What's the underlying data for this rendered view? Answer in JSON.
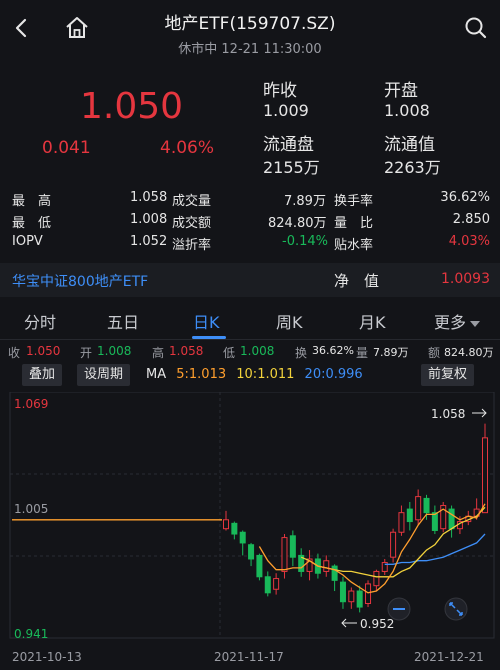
{
  "header": {
    "title": "地产ETF(159707.SZ)",
    "subtitle": "休市中 12-21 11:30:00"
  },
  "quote": {
    "price": "1.050",
    "change": "0.041",
    "change_pct": "4.06%",
    "prev_close_label": "昨收",
    "prev_close": "1.009",
    "open_label": "开盘",
    "open": "1.008",
    "float_shares_label": "流通盘",
    "float_shares": "2155万",
    "float_value_label": "流通值",
    "float_value": "2263万"
  },
  "stats": [
    {
      "l1": "最　高",
      "v1": "1.058",
      "l2": "成交量",
      "v2": "7.89万",
      "l3": "换手率",
      "v3": "36.62%"
    },
    {
      "l1": "最　低",
      "v1": "1.008",
      "l2": "成交额",
      "v2": "824.80万",
      "l3": "量　比",
      "v3": "2.850"
    },
    {
      "l1": "IOPV",
      "v1": "1.052",
      "l2": "溢折率",
      "v2": "-0.14%",
      "l3": "贴水率",
      "v3": "4.03%"
    }
  ],
  "fund": {
    "name": "华宝中证800地产ETF",
    "nav_label": "净　值",
    "nav": "1.0093"
  },
  "tabs": [
    "分时",
    "五日",
    "日K",
    "周K",
    "月K",
    "更多"
  ],
  "ohlc": {
    "close_label": "收",
    "close": "1.050",
    "open_label": "开",
    "open": "1.008",
    "high_label": "高",
    "high": "1.058",
    "low_label": "低",
    "low": "1.008",
    "turnover_label": "换",
    "turnover": "36.62%",
    "volume_label": "量",
    "volume": "7.89万",
    "amount_label": "额",
    "amount": "824.80万"
  },
  "controls": {
    "overlay": "叠加",
    "period": "设周期",
    "adjust": "前复权"
  },
  "ma": {
    "label": "MA",
    "ma5": "5:1.013",
    "ma10": "10:1.011",
    "ma20": "20:0.996"
  },
  "colors": {
    "up": "#e5363f",
    "down": "#19b95a",
    "ma5": "#ff9f2e",
    "ma10": "#f2d23c",
    "ma20": "#3e8ef7",
    "accent": "#3e8ef7"
  },
  "chart_data": {
    "type": "candlestick",
    "y_ticks": [
      "1.069",
      "1.005",
      "0.941"
    ],
    "x_ticks": [
      "2021-10-13",
      "2021-11-17",
      "2021-12-21"
    ],
    "ylim": [
      0.941,
      1.069
    ],
    "annotations": {
      "high": "1.058",
      "low": "0.952"
    },
    "prelisting_flat_value": 1.004,
    "candles": [
      {
        "o": 0.999,
        "c": 1.004,
        "h": 1.009,
        "l": 0.998
      },
      {
        "o": 1.002,
        "c": 0.996,
        "h": 1.003,
        "l": 0.993
      },
      {
        "o": 0.997,
        "c": 0.991,
        "h": 0.998,
        "l": 0.984
      },
      {
        "o": 0.99,
        "c": 0.982,
        "h": 0.991,
        "l": 0.978
      },
      {
        "o": 0.984,
        "c": 0.972,
        "h": 0.985,
        "l": 0.97
      },
      {
        "o": 0.972,
        "c": 0.963,
        "h": 0.975,
        "l": 0.961
      },
      {
        "o": 0.965,
        "c": 0.971,
        "h": 0.974,
        "l": 0.962
      },
      {
        "o": 0.975,
        "c": 0.994,
        "h": 0.996,
        "l": 0.971
      },
      {
        "o": 0.995,
        "c": 0.983,
        "h": 0.998,
        "l": 0.978
      },
      {
        "o": 0.984,
        "c": 0.975,
        "h": 0.988,
        "l": 0.972
      },
      {
        "o": 0.975,
        "c": 0.982,
        "h": 0.987,
        "l": 0.97
      },
      {
        "o": 0.982,
        "c": 0.974,
        "h": 0.985,
        "l": 0.971
      },
      {
        "o": 0.975,
        "c": 0.981,
        "h": 0.984,
        "l": 0.972
      },
      {
        "o": 0.978,
        "c": 0.97,
        "h": 0.979,
        "l": 0.964
      },
      {
        "o": 0.969,
        "c": 0.958,
        "h": 0.972,
        "l": 0.954
      },
      {
        "o": 0.958,
        "c": 0.964,
        "h": 0.966,
        "l": 0.954
      },
      {
        "o": 0.964,
        "c": 0.955,
        "h": 0.967,
        "l": 0.952
      },
      {
        "o": 0.957,
        "c": 0.968,
        "h": 0.97,
        "l": 0.955
      },
      {
        "o": 0.967,
        "c": 0.975,
        "h": 0.976,
        "l": 0.964
      },
      {
        "o": 0.975,
        "c": 0.98,
        "h": 0.982,
        "l": 0.973
      },
      {
        "o": 0.983,
        "c": 0.997,
        "h": 0.999,
        "l": 0.98
      },
      {
        "o": 0.997,
        "c": 1.008,
        "h": 1.012,
        "l": 0.995
      },
      {
        "o": 1.01,
        "c": 1.003,
        "h": 1.014,
        "l": 0.998
      },
      {
        "o": 1.004,
        "c": 1.017,
        "h": 1.021,
        "l": 1.001
      },
      {
        "o": 1.016,
        "c": 1.008,
        "h": 1.018,
        "l": 1.004
      },
      {
        "o": 1.008,
        "c": 0.998,
        "h": 1.012,
        "l": 0.996
      },
      {
        "o": 0.999,
        "c": 1.012,
        "h": 1.014,
        "l": 0.997
      },
      {
        "o": 1.01,
        "c": 0.999,
        "h": 1.012,
        "l": 0.994
      },
      {
        "o": 0.999,
        "c": 1.003,
        "h": 1.006,
        "l": 0.996
      },
      {
        "o": 1.003,
        "c": 1.006,
        "h": 1.009,
        "l": 1.001
      },
      {
        "o": 1.006,
        "c": 1.01,
        "h": 1.016,
        "l": 1.004
      },
      {
        "o": 1.008,
        "c": 1.05,
        "h": 1.058,
        "l": 1.008
      }
    ],
    "ma5": [
      null,
      null,
      null,
      null,
      0.989,
      0.981,
      0.976,
      0.976,
      0.977,
      0.977,
      0.981,
      0.978,
      0.977,
      0.976,
      0.973,
      0.969,
      0.966,
      0.963,
      0.964,
      0.968,
      0.975,
      0.986,
      0.993,
      1.001,
      1.007,
      1.007,
      1.01,
      1.007,
      1.004,
      1.006,
      1.005,
      1.013
    ],
    "ma10": [
      null,
      null,
      null,
      null,
      null,
      null,
      null,
      null,
      null,
      0.983,
      0.981,
      0.978,
      0.977,
      0.976,
      0.975,
      0.975,
      0.974,
      0.973,
      0.972,
      0.972,
      0.972,
      0.975,
      0.977,
      0.982,
      0.987,
      0.99,
      0.996,
      0.999,
      1.002,
      1.004,
      1.006,
      1.011
    ],
    "ma20": [
      null,
      null,
      null,
      null,
      null,
      null,
      null,
      null,
      null,
      null,
      null,
      null,
      null,
      null,
      null,
      null,
      null,
      null,
      null,
      0.979,
      0.979,
      0.98,
      0.98,
      0.981,
      0.981,
      0.982,
      0.983,
      0.985,
      0.987,
      0.989,
      0.991,
      0.996
    ]
  }
}
